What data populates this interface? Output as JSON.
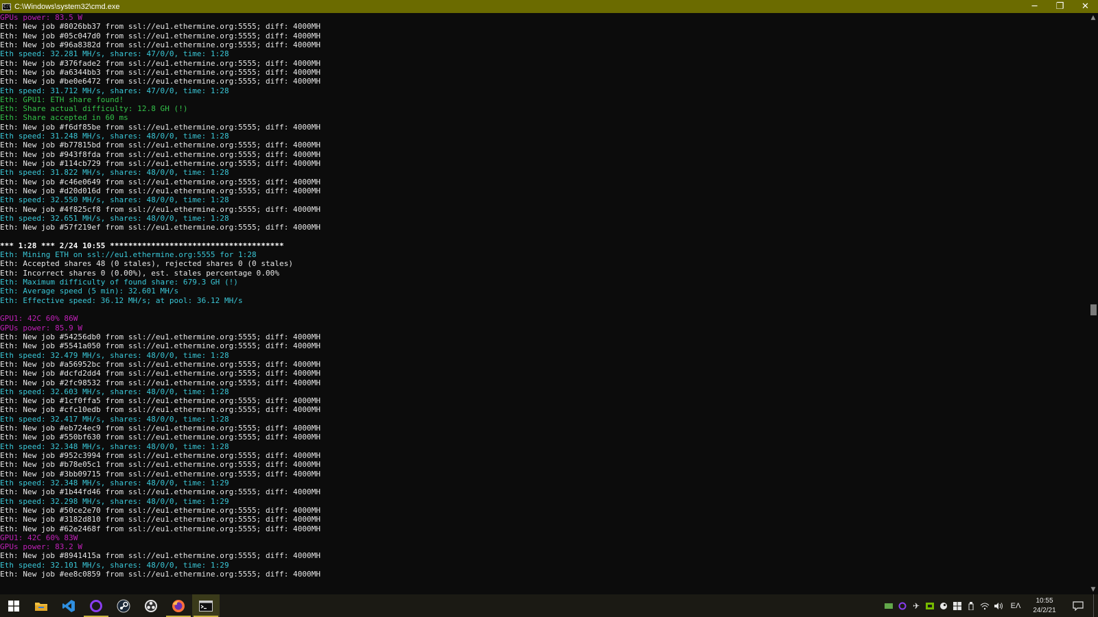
{
  "window": {
    "title": "C:\\Windows\\system32\\cmd.exe",
    "app_icon_text": "C:\\",
    "minimize": "─",
    "restore": "❐",
    "close": "✕"
  },
  "colors": {
    "titlebar": "#6b6b00",
    "background": "#0c0c0c",
    "white": "#e8e8e8",
    "cyan": "#3ac8d8",
    "green": "#33c34a",
    "magenta": "#c020b8"
  },
  "console_lines": [
    {
      "text": "GPUs power: 83.5 W",
      "color": "magenta"
    },
    {
      "text": "Eth: New job #8026bb37 from ssl://eu1.ethermine.org:5555; diff: 4000MH",
      "color": "white"
    },
    {
      "text": "Eth: New job #05c047d0 from ssl://eu1.ethermine.org:5555; diff: 4000MH",
      "color": "white"
    },
    {
      "text": "Eth: New job #96a8382d from ssl://eu1.ethermine.org:5555; diff: 4000MH",
      "color": "white"
    },
    {
      "text": "Eth speed: 32.281 MH/s, shares: 47/0/0, time: 1:28",
      "color": "cyan"
    },
    {
      "text": "Eth: New job #376fade2 from ssl://eu1.ethermine.org:5555; diff: 4000MH",
      "color": "white"
    },
    {
      "text": "Eth: New job #a6344bb3 from ssl://eu1.ethermine.org:5555; diff: 4000MH",
      "color": "white"
    },
    {
      "text": "Eth: New job #be0e6472 from ssl://eu1.ethermine.org:5555; diff: 4000MH",
      "color": "white"
    },
    {
      "text": "Eth speed: 31.712 MH/s, shares: 47/0/0, time: 1:28",
      "color": "cyan"
    },
    {
      "text": "Eth: GPU1: ETH share found!",
      "color": "green"
    },
    {
      "text": "Eth: Share actual difficulty: 12.8 GH (!)",
      "color": "green"
    },
    {
      "text": "Eth: Share accepted in 60 ms",
      "color": "green"
    },
    {
      "text": "Eth: New job #f6df85be from ssl://eu1.ethermine.org:5555; diff: 4000MH",
      "color": "white"
    },
    {
      "text": "Eth speed: 31.248 MH/s, shares: 48/0/0, time: 1:28",
      "color": "cyan"
    },
    {
      "text": "Eth: New job #b77815bd from ssl://eu1.ethermine.org:5555; diff: 4000MH",
      "color": "white"
    },
    {
      "text": "Eth: New job #943f8fda from ssl://eu1.ethermine.org:5555; diff: 4000MH",
      "color": "white"
    },
    {
      "text": "Eth: New job #114cb729 from ssl://eu1.ethermine.org:5555; diff: 4000MH",
      "color": "white"
    },
    {
      "text": "Eth speed: 31.822 MH/s, shares: 48/0/0, time: 1:28",
      "color": "cyan"
    },
    {
      "text": "Eth: New job #c46e0649 from ssl://eu1.ethermine.org:5555; diff: 4000MH",
      "color": "white"
    },
    {
      "text": "Eth: New job #d20d016d from ssl://eu1.ethermine.org:5555; diff: 4000MH",
      "color": "white"
    },
    {
      "text": "Eth speed: 32.550 MH/s, shares: 48/0/0, time: 1:28",
      "color": "cyan"
    },
    {
      "text": "Eth: New job #4f825cf8 from ssl://eu1.ethermine.org:5555; diff: 4000MH",
      "color": "white"
    },
    {
      "text": "Eth speed: 32.651 MH/s, shares: 48/0/0, time: 1:28",
      "color": "cyan"
    },
    {
      "text": "Eth: New job #57f219ef from ssl://eu1.ethermine.org:5555; diff: 4000MH",
      "color": "white"
    },
    {
      "text": "",
      "color": "white"
    },
    {
      "text": "*** 1:28 *** 2/24 10:55 **************************************",
      "color": "bold"
    },
    {
      "text": "Eth: Mining ETH on ssl://eu1.ethermine.org:5555 for 1:28",
      "color": "cyan"
    },
    {
      "text": "Eth: Accepted shares 48 (0 stales), rejected shares 0 (0 stales)",
      "color": "white"
    },
    {
      "text": "Eth: Incorrect shares 0 (0.00%), est. stales percentage 0.00%",
      "color": "white"
    },
    {
      "text": "Eth: Maximum difficulty of found share: 679.3 GH (!)",
      "color": "cyan"
    },
    {
      "text": "Eth: Average speed (5 min): 32.601 MH/s",
      "color": "cyan"
    },
    {
      "text": "Eth: Effective speed: 36.12 MH/s; at pool: 36.12 MH/s",
      "color": "cyan"
    },
    {
      "text": "",
      "color": "white"
    },
    {
      "text": "GPU1: 42C 60% 86W",
      "color": "magenta"
    },
    {
      "text": "GPUs power: 85.9 W",
      "color": "magenta"
    },
    {
      "text": "Eth: New job #54256db0 from ssl://eu1.ethermine.org:5555; diff: 4000MH",
      "color": "white"
    },
    {
      "text": "Eth: New job #5541a050 from ssl://eu1.ethermine.org:5555; diff: 4000MH",
      "color": "white"
    },
    {
      "text": "Eth speed: 32.479 MH/s, shares: 48/0/0, time: 1:28",
      "color": "cyan"
    },
    {
      "text": "Eth: New job #a56952bc from ssl://eu1.ethermine.org:5555; diff: 4000MH",
      "color": "white"
    },
    {
      "text": "Eth: New job #dcfd2dd4 from ssl://eu1.ethermine.org:5555; diff: 4000MH",
      "color": "white"
    },
    {
      "text": "Eth: New job #2fc98532 from ssl://eu1.ethermine.org:5555; diff: 4000MH",
      "color": "white"
    },
    {
      "text": "Eth speed: 32.603 MH/s, shares: 48/0/0, time: 1:28",
      "color": "cyan"
    },
    {
      "text": "Eth: New job #1cf0ffa5 from ssl://eu1.ethermine.org:5555; diff: 4000MH",
      "color": "white"
    },
    {
      "text": "Eth: New job #cfc10edb from ssl://eu1.ethermine.org:5555; diff: 4000MH",
      "color": "white"
    },
    {
      "text": "Eth speed: 32.417 MH/s, shares: 48/0/0, time: 1:28",
      "color": "cyan"
    },
    {
      "text": "Eth: New job #eb724ec9 from ssl://eu1.ethermine.org:5555; diff: 4000MH",
      "color": "white"
    },
    {
      "text": "Eth: New job #550bf630 from ssl://eu1.ethermine.org:5555; diff: 4000MH",
      "color": "white"
    },
    {
      "text": "Eth speed: 32.348 MH/s, shares: 48/0/0, time: 1:28",
      "color": "cyan"
    },
    {
      "text": "Eth: New job #952c3994 from ssl://eu1.ethermine.org:5555; diff: 4000MH",
      "color": "white"
    },
    {
      "text": "Eth: New job #b78e05c1 from ssl://eu1.ethermine.org:5555; diff: 4000MH",
      "color": "white"
    },
    {
      "text": "Eth: New job #3bb09715 from ssl://eu1.ethermine.org:5555; diff: 4000MH",
      "color": "white"
    },
    {
      "text": "Eth speed: 32.348 MH/s, shares: 48/0/0, time: 1:29",
      "color": "cyan"
    },
    {
      "text": "Eth: New job #1b44fd46 from ssl://eu1.ethermine.org:5555; diff: 4000MH",
      "color": "white"
    },
    {
      "text": "Eth speed: 32.298 MH/s, shares: 48/0/0, time: 1:29",
      "color": "cyan"
    },
    {
      "text": "Eth: New job #50ce2e70 from ssl://eu1.ethermine.org:5555; diff: 4000MH",
      "color": "white"
    },
    {
      "text": "Eth: New job #3182d810 from ssl://eu1.ethermine.org:5555; diff: 4000MH",
      "color": "white"
    },
    {
      "text": "Eth: New job #62e2468f from ssl://eu1.ethermine.org:5555; diff: 4000MH",
      "color": "white"
    },
    {
      "text": "GPU1: 42C 60% 83W",
      "color": "magenta"
    },
    {
      "text": "GPUs power: 83.2 W",
      "color": "magenta"
    },
    {
      "text": "Eth: New job #8941415a from ssl://eu1.ethermine.org:5555; diff: 4000MH",
      "color": "white"
    },
    {
      "text": "Eth speed: 32.101 MH/s, shares: 48/0/0, time: 1:29",
      "color": "cyan"
    },
    {
      "text": "Eth: New job #ee8c0859 from ssl://eu1.ethermine.org:5555; diff: 4000MH",
      "color": "white"
    }
  ],
  "taskbar": {
    "apps": [
      {
        "name": "start-button",
        "icon": "windows-logo-icon"
      },
      {
        "name": "file-explorer",
        "icon": "folder-icon"
      },
      {
        "name": "vscode",
        "icon": "vscode-icon"
      },
      {
        "name": "circle-app",
        "icon": "ring-icon",
        "running": true
      },
      {
        "name": "steam",
        "icon": "steam-icon"
      },
      {
        "name": "obs",
        "icon": "obs-icon"
      },
      {
        "name": "firefox",
        "icon": "firefox-icon",
        "running": true
      },
      {
        "name": "cmd",
        "icon": "terminal-icon",
        "active": true
      }
    ],
    "language": "EΛ",
    "time": "10:55",
    "date": "24/2/21"
  }
}
